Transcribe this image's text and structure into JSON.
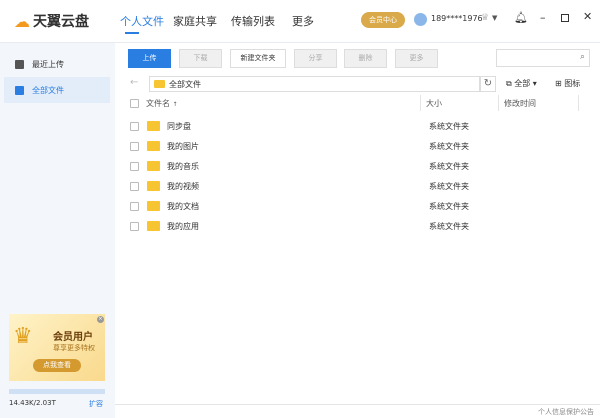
{
  "app": {
    "name": "天翼云盘"
  },
  "nav": [
    {
      "label": "个人文件",
      "active": true
    },
    {
      "label": "家庭共享"
    },
    {
      "label": "传输列表"
    },
    {
      "label": "更多"
    }
  ],
  "header": {
    "vip_label": "会员中心",
    "user": "189****1976",
    "icons": [
      "crown-icon",
      "chevron-down-icon",
      "bell-icon",
      "minimize-icon",
      "maximize-icon",
      "close-icon"
    ]
  },
  "sidebar": {
    "items": [
      {
        "label": "最近上传"
      },
      {
        "label": "全部文件",
        "active": true
      }
    ],
    "promo": {
      "title": "会员用户",
      "subtitle": "尊享更多特权",
      "button": "点我查看"
    },
    "storage": {
      "text": "14.43K/2.03T",
      "expand": "扩容",
      "used_fraction": 0.0
    }
  },
  "toolbar": {
    "upload": "上传",
    "download": "下载",
    "new_folder": "新建文件夹",
    "share": "分享",
    "delete": "删除",
    "more": "更多",
    "search_placeholder": ""
  },
  "pathbar": {
    "path": "全部文件",
    "filter": "全部",
    "view": "图标"
  },
  "columns": {
    "name": "文件名",
    "sort": "↑",
    "size": "大小",
    "modified": "修改时间"
  },
  "files": [
    {
      "name": "同步盘",
      "size": "系统文件夹"
    },
    {
      "name": "我的图片",
      "size": "系统文件夹"
    },
    {
      "name": "我的音乐",
      "size": "系统文件夹"
    },
    {
      "name": "我的视频",
      "size": "系统文件夹"
    },
    {
      "name": "我的文档",
      "size": "系统文件夹"
    },
    {
      "name": "我的应用",
      "size": "系统文件夹"
    }
  ],
  "footer": {
    "privacy": "个人信息保护公告"
  },
  "colors": {
    "accent": "#2a7de1",
    "vip": "#d9a94a",
    "folder": "#f7c531"
  }
}
